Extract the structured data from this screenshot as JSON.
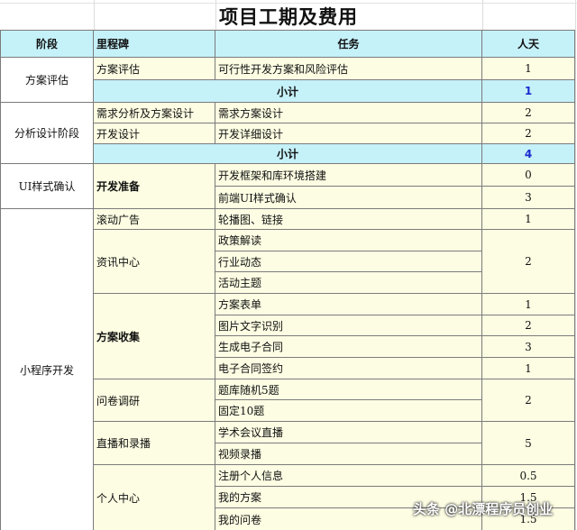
{
  "title": "项目工期及费用",
  "header": [
    "阶段",
    "里程碑",
    "任务",
    "人天"
  ],
  "phases": [
    "方案评估",
    "分析设计阶段",
    "UI样式确认",
    "小程序开发"
  ],
  "milestones": {
    "m1": "方案评估",
    "m2": "需求分析及方案设计",
    "m3": "开发设计",
    "m4": "开发准备",
    "m5": "滚动广告",
    "m6": "资讯中心",
    "m7": "方案收集",
    "m8": "问卷调研",
    "m9": "直播和录播",
    "m10": "个人中心"
  },
  "tasks": {
    "t1": "可行性开发方案和风险评估",
    "t2": "需求方案设计",
    "t3": "开发详细设计",
    "t4": "开发框架和库环境搭建",
    "t5": "前端UI样式确认",
    "t6": "轮播图、链接",
    "t7": "政策解读",
    "t8": "行业动态",
    "t9": "活动主题",
    "t10": "方案表单",
    "t11": "图片文字识别",
    "t12": "生成电子合同",
    "t13": "电子合同签约",
    "t14": "题库随机5题",
    "t15": "固定10题",
    "t16": "学术会议直播",
    "t17": "视频录播",
    "t18": "注册个人信息",
    "t19": "我的方案",
    "t20": "我的问卷"
  },
  "subtotal_label": "小计",
  "days": {
    "d1": "1",
    "s1": "1",
    "d2": "2",
    "d3": "2",
    "s2": "4",
    "d4": "0",
    "d5": "3",
    "d6": "1",
    "d7": "2",
    "d10": "1",
    "d11": "2",
    "d12": "3",
    "d13": "1",
    "d14": "2",
    "d16": "5",
    "d18": "0.5",
    "d19": "1.5",
    "d20": "1.5"
  },
  "watermark": "头条 @北漂程序员创业",
  "colors": {
    "header_bg": "#c5f1f9",
    "cell_bg": "#fdfde3",
    "subtotal_text": "#1b2ccf"
  }
}
